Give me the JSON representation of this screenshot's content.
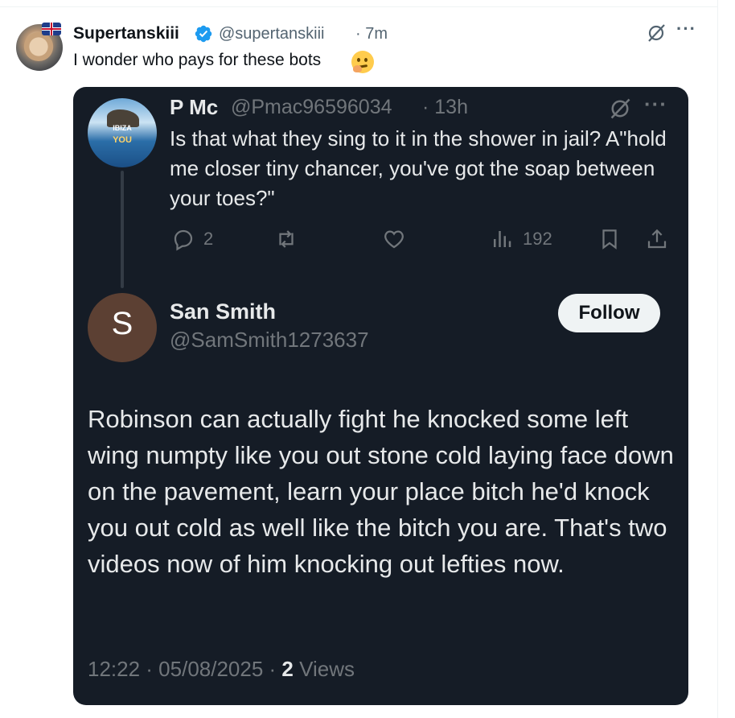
{
  "outer": {
    "name": "Supertanskiii",
    "handle": "@supertanskiii",
    "time": "· 7m",
    "text": "I wonder who pays for these bots",
    "more": "···"
  },
  "quoted": {
    "name": "P Mc",
    "handle": "@Pmac96596034",
    "time": "· 13h",
    "more": "···",
    "text": "Is that what they sing to it in the shower in jail? A\"hold me closer tiny chancer, you've got the soap between your toes?\"",
    "avatar_line1": "IBIZA",
    "avatar_line2": "YOU",
    "reply_count": "2",
    "views_count": "192"
  },
  "reply": {
    "avatar_initial": "S",
    "name": "San Smith",
    "handle": "@SamSmith1273637",
    "follow_label": "Follow",
    "text": "Robinson can actually fight he knocked some left wing numpty like you out stone cold laying face down on the pavement, learn your place bitch he'd knock you out cold as well like the bitch you are. That's two videos now of him knocking out lefties now.",
    "timestamp": "12:22 · 05/08/2025 ·",
    "views_number": "2",
    "views_label": "Views"
  },
  "colors": {
    "card_bg": "#151c26",
    "verified": "#1d9bf0",
    "text_light": "#e7e9ea",
    "text_muted": "#71767b"
  },
  "icons": [
    "verified-badge-icon",
    "grok-icon",
    "more-icon",
    "reply-icon",
    "retweet-icon",
    "like-icon",
    "views-icon",
    "bookmark-icon",
    "share-icon",
    "thinking-emoji-icon"
  ]
}
